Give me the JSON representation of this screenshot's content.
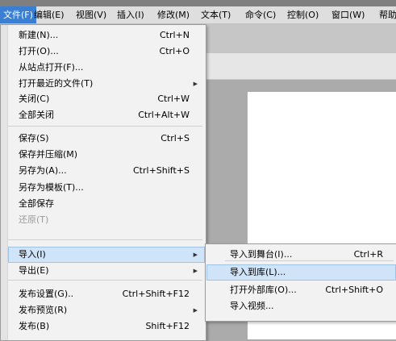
{
  "menubar": {
    "items": [
      "文件(F)",
      "编辑(E)",
      "视图(V)",
      "插入(I)",
      "修改(M)",
      "文本(T)",
      "命令(C)",
      "控制(O)",
      "窗口(W)",
      "帮助"
    ],
    "active_index": 0
  },
  "file_menu": {
    "items": [
      {
        "label": "新建(N)...",
        "shortcut": "Ctrl+N"
      },
      {
        "label": "打开(O)...",
        "shortcut": "Ctrl+O"
      },
      {
        "label": "从站点打开(F)..."
      },
      {
        "label": "打开最近的文件(T)",
        "submenu": true
      },
      {
        "label": "关闭(C)",
        "shortcut": "Ctrl+W"
      },
      {
        "label": "全部关闭",
        "shortcut": "Ctrl+Alt+W"
      },
      {
        "label": "保存(S)",
        "shortcut": "Ctrl+S"
      },
      {
        "label": "保存并压缩(M)"
      },
      {
        "label": "另存为(A)...",
        "shortcut": "Ctrl+Shift+S"
      },
      {
        "label": "另存为模板(T)..."
      },
      {
        "label": "全部保存"
      },
      {
        "label": "还原(T)",
        "disabled": true
      },
      {
        "label": "导入(I)",
        "submenu": true,
        "highlighted": true
      },
      {
        "label": "导出(E)",
        "submenu": true
      },
      {
        "label": "发布设置(G)..",
        "shortcut": "Ctrl+Shift+F12"
      },
      {
        "label": "发布预览(R)",
        "submenu": true
      },
      {
        "label": "发布(B)",
        "shortcut": "Shift+F12"
      }
    ]
  },
  "import_menu": {
    "items": [
      {
        "label": "导入到舞台(I)...",
        "shortcut": "Ctrl+R"
      },
      {
        "label": "导入到库(L)...",
        "highlighted": true
      },
      {
        "label": "打开外部库(O)...",
        "shortcut": "Ctrl+Shift+O"
      },
      {
        "label": "导入视频..."
      }
    ]
  }
}
